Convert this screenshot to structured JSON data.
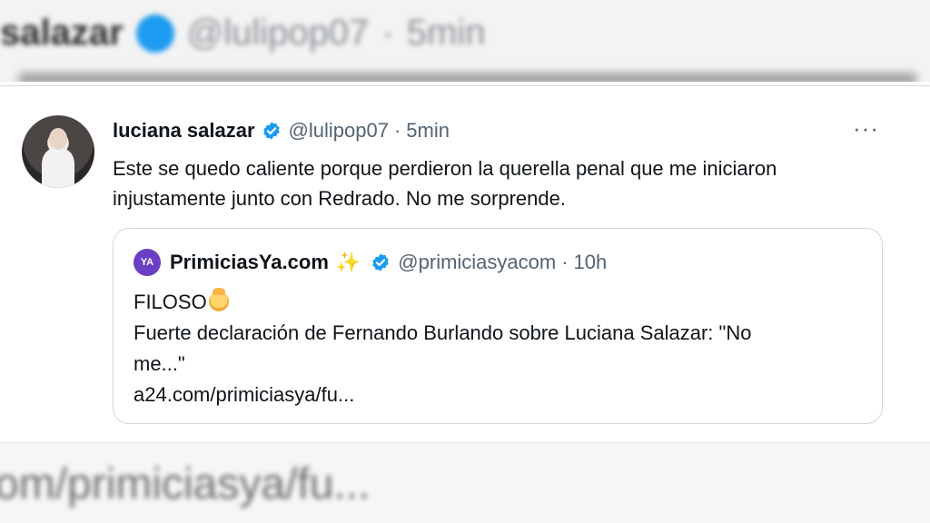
{
  "background_top": {
    "name": "salazar",
    "handle": "@lulipop07",
    "time": "5min"
  },
  "tweet": {
    "author_name": "luciana salazar",
    "handle": "@lulipop07",
    "separator": "·",
    "time": "5min",
    "more_label": "···",
    "text_line1": "Este se quedo caliente porque perdieron la querella penal que me iniciaron",
    "text_line2": "injustamente junto con Redrado. No me sorprende."
  },
  "quoted_tweet": {
    "logo_text": "YA",
    "author_name": "PrimiciasYa.com",
    "sparkle": "✨",
    "handle": "@primiciasyacom",
    "separator": "·",
    "time": "10h",
    "line1": "FILOSO",
    "line2": "Fuerte declaración de Fernando Burlando sobre Luciana Salazar: \"No",
    "line3": "me...\"",
    "link": "a24.com/primiciasya/fu..."
  },
  "background_bottom": {
    "text": "om/primiciasya/fu..."
  },
  "colors": {
    "verified": "#1d9bf0",
    "muted": "#536471",
    "logo": "#6b3fc4"
  }
}
